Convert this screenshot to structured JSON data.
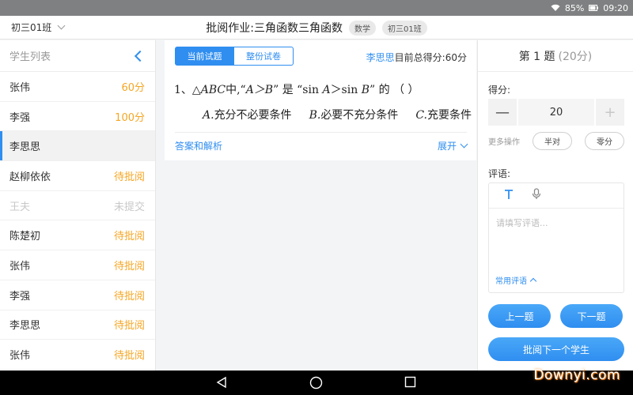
{
  "status": {
    "battery": "85%",
    "time": "09:20"
  },
  "header": {
    "class_name": "初三01班",
    "title_prefix": "批阅作业:",
    "title": "三角函数三角函数",
    "tag_subject": "数学",
    "tag_class": "初三01班"
  },
  "sidebar": {
    "title": "学生列表",
    "students": [
      {
        "name": "张伟",
        "status": "60分",
        "state": "scored"
      },
      {
        "name": "李强",
        "status": "100分",
        "state": "scored"
      },
      {
        "name": "李思思",
        "status": "",
        "state": "active"
      },
      {
        "name": "赵柳依依",
        "status": "待批阅",
        "state": "pending"
      },
      {
        "name": "王夫",
        "status": "未提交",
        "state": "unsubmitted"
      },
      {
        "name": "陈楚初",
        "status": "待批阅",
        "state": "pending"
      },
      {
        "name": "张伟",
        "status": "待批阅",
        "state": "pending"
      },
      {
        "name": "李强",
        "status": "待批阅",
        "state": "pending"
      },
      {
        "name": "李思思",
        "status": "待批阅",
        "state": "pending"
      },
      {
        "name": "张伟",
        "status": "待批阅",
        "state": "pending"
      }
    ]
  },
  "main": {
    "tab_current": "当前试题",
    "tab_full": "整份试卷",
    "student_name": "李思思",
    "total_label": "目前总得分:",
    "total_score": "60分",
    "question_num": "1、",
    "question_tri": "△",
    "question_abc": "ABC",
    "question_mid": "中,“",
    "question_cond": "A＞B",
    "question_is": "” 是 “sin ",
    "question_a": "A",
    "question_gt": "＞sin ",
    "question_b": "B",
    "question_end": "” 的 （    ）",
    "options": [
      {
        "letter": "A.",
        "text": "充分不必要条件"
      },
      {
        "letter": "B.",
        "text": "必要不充分条件"
      },
      {
        "letter": "C.",
        "text": "充要条件"
      }
    ],
    "answer_link": "答案和解析",
    "expand_link": "展开"
  },
  "right": {
    "question_title": "第 1 题",
    "question_points": "(20分)",
    "score_label": "得分:",
    "score_value": "20",
    "minus": "—",
    "plus": "+",
    "more_ops": "更多操作",
    "half_btn": "半对",
    "zero_btn": "零分",
    "comment_label": "评语:",
    "comment_placeholder": "请填写评语...",
    "common_comments": "常用评语",
    "prev_btn": "上一题",
    "next_btn": "下一题",
    "review_next_btn": "批阅下一个学生"
  },
  "watermark": "Downyi.com",
  "colors": {
    "accent": "#2f8ef0",
    "pending": "#f5a623"
  }
}
